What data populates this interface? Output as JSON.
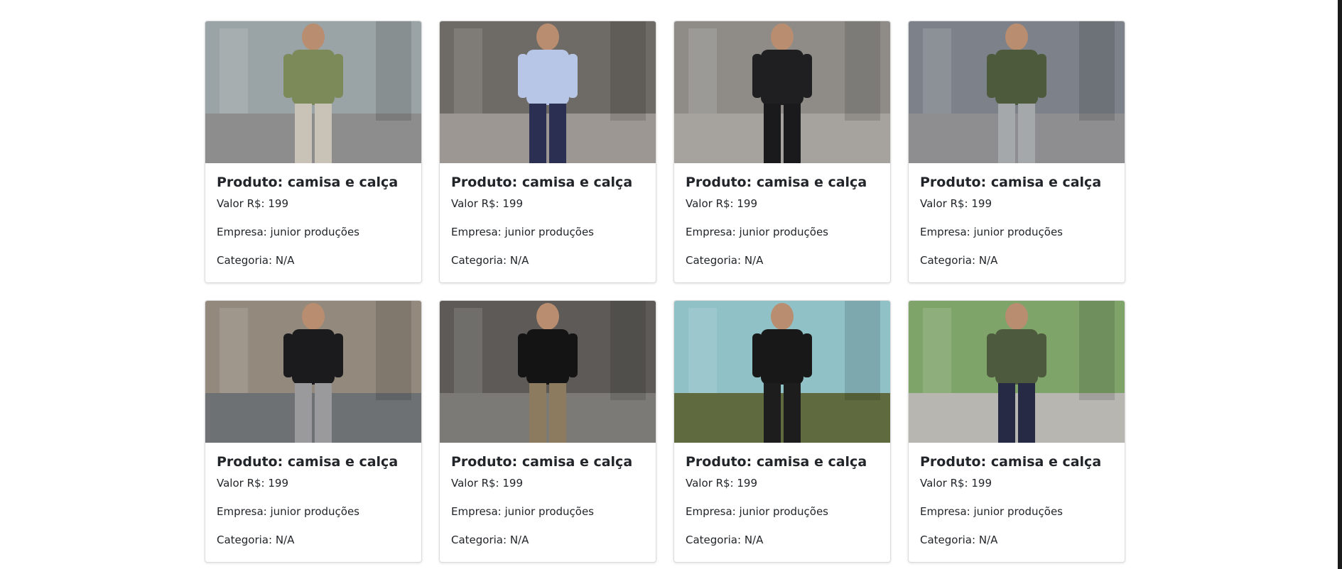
{
  "products": [
    {
      "title": "Produto: camisa e calça",
      "price": "Valor R$: 199",
      "company": "Empresa: junior produções",
      "category": "Categoria: N/A",
      "image": {
        "bg": "#9aa3a6",
        "ground": "#8d8d8d",
        "top": "#7c8a5a",
        "bottom": "#c9c2b6"
      }
    },
    {
      "title": "Produto: camisa e calça",
      "price": "Valor R$: 199",
      "company": "Empresa: junior produções",
      "category": "Categoria: N/A",
      "image": {
        "bg": "#6e6a66",
        "ground": "#9c9792",
        "top": "#b7c6e6",
        "bottom": "#2b2f52"
      }
    },
    {
      "title": "Produto: camisa e calça",
      "price": "Valor R$: 199",
      "company": "Empresa: junior produções",
      "category": "Categoria: N/A",
      "image": {
        "bg": "#8f8c88",
        "ground": "#a6a29d",
        "top": "#1f1f22",
        "bottom": "#1a1a1d"
      }
    },
    {
      "title": "Produto: camisa e calça",
      "price": "Valor R$: 199",
      "company": "Empresa: junior produções",
      "category": "Categoria: N/A",
      "image": {
        "bg": "#7d8189",
        "ground": "#8e8e90",
        "top": "#4e5a3c",
        "bottom": "#a5a8aa"
      }
    },
    {
      "title": "Produto: camisa e calça",
      "price": "Valor R$: 199",
      "company": "Empresa: junior produções",
      "category": "Categoria: N/A",
      "image": {
        "bg": "#93897d",
        "ground": "#6e7174",
        "top": "#1b1b1d",
        "bottom": "#9a9a9c"
      }
    },
    {
      "title": "Produto: camisa e calça",
      "price": "Valor R$: 199",
      "company": "Empresa: junior produções",
      "category": "Categoria: N/A",
      "image": {
        "bg": "#5d5a57",
        "ground": "#7c7a77",
        "top": "#141414",
        "bottom": "#8c7b5e"
      }
    },
    {
      "title": "Produto: camisa e calça",
      "price": "Valor R$: 199",
      "company": "Empresa: junior produções",
      "category": "Categoria: N/A",
      "image": {
        "bg": "#8fc1c6",
        "ground": "#5f6b3e",
        "top": "#181818",
        "bottom": "#1d1d1d"
      }
    },
    {
      "title": "Produto: camisa e calça",
      "price": "Valor R$: 199",
      "company": "Empresa: junior produções",
      "category": "Categoria: N/A",
      "image": {
        "bg": "#7fa46a",
        "ground": "#b8b6b1",
        "top": "#4d5a3d",
        "bottom": "#262a45"
      }
    }
  ]
}
